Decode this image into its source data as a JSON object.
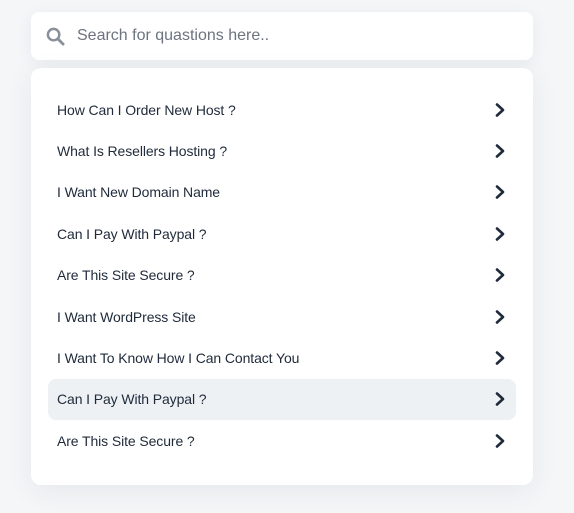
{
  "search": {
    "placeholder": "Search for quastions here..",
    "value": ""
  },
  "faq": {
    "items": [
      {
        "label": "How Can I Order New Host ?",
        "active": false
      },
      {
        "label": "What Is Resellers Hosting ?",
        "active": false
      },
      {
        "label": "I Want New Domain Name",
        "active": false
      },
      {
        "label": "Can I Pay With Paypal ?",
        "active": false
      },
      {
        "label": "Are This Site Secure ?",
        "active": false
      },
      {
        "label": "I Want WordPress Site",
        "active": false
      },
      {
        "label": "I Want To Know How I Can Contact You",
        "active": false
      },
      {
        "label": "Can I Pay With Paypal ?",
        "active": true
      },
      {
        "label": "Are This Site Secure ?",
        "active": false
      }
    ]
  },
  "icons": {
    "search": "search-icon",
    "item_arrow": "chevron-right-icon"
  },
  "colors": {
    "page_background": "#f5f6f8",
    "card_background": "#ffffff",
    "active_row": "#eef1f4",
    "text": "#1f2a3a",
    "placeholder": "#6c7480",
    "search_icon": "#8a9099"
  }
}
